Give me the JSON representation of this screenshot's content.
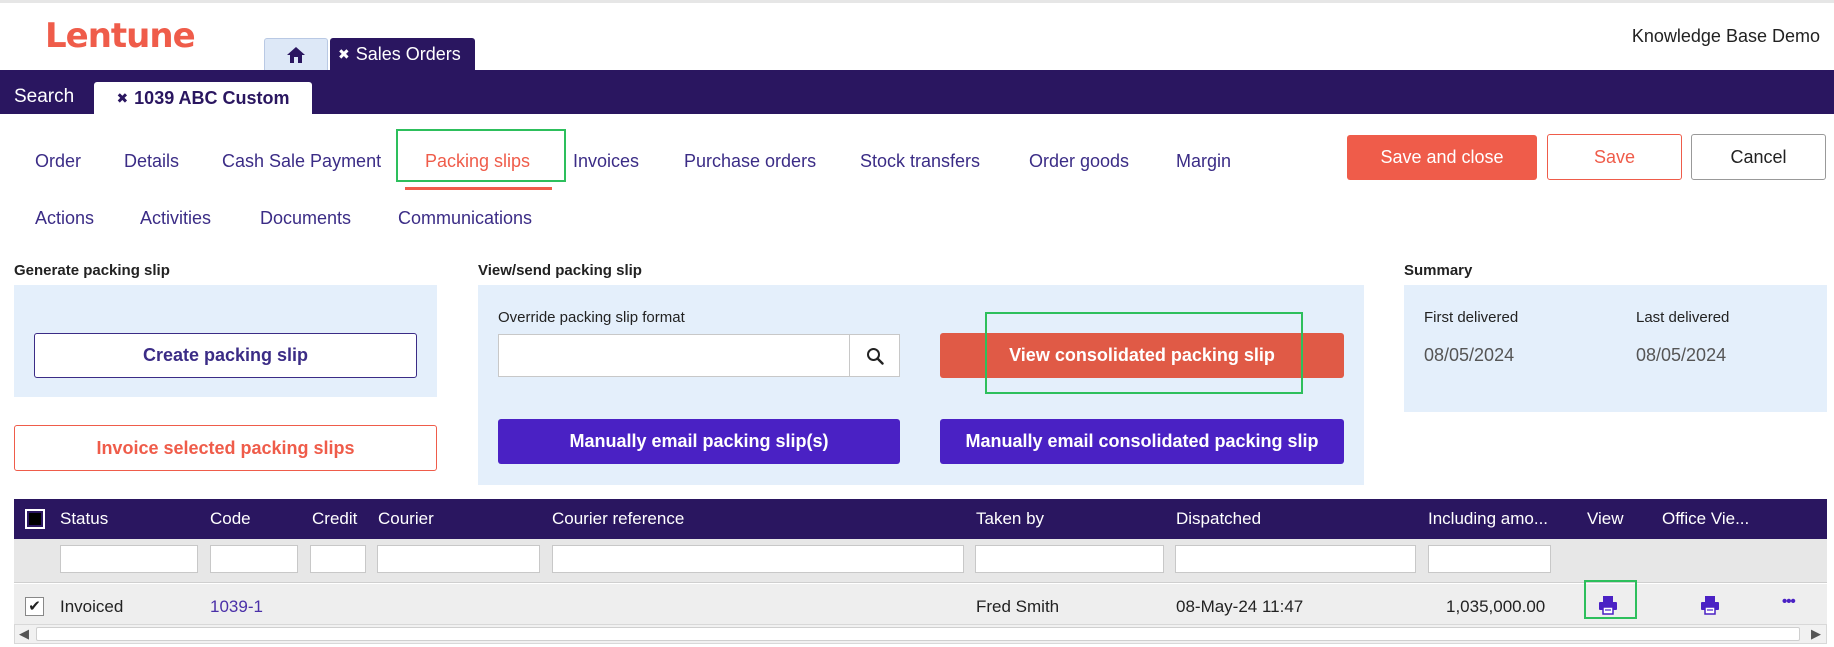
{
  "app": {
    "logo_text": "Lentune",
    "workspace": "Knowledge Base Demo",
    "tabs": [
      {
        "label": "Sales Orders",
        "close": "✖"
      }
    ],
    "subtabs": [
      {
        "label": "Search"
      },
      {
        "label": "1039 ABC Custom",
        "close": "✖"
      }
    ]
  },
  "nav": {
    "row1": [
      "Order",
      "Details",
      "Cash Sale Payment",
      "Packing slips",
      "Invoices",
      "Purchase orders",
      "Stock transfers",
      "Order goods",
      "Margin"
    ],
    "row2": [
      "Actions",
      "Activities",
      "Documents",
      "Communications"
    ],
    "active": "Packing slips"
  },
  "actions": {
    "save_close": "Save and close",
    "save": "Save",
    "cancel": "Cancel"
  },
  "generate": {
    "title": "Generate packing slip",
    "create_button": "Create packing slip",
    "invoice_button": "Invoice selected packing slips"
  },
  "view_send": {
    "title": "View/send packing slip",
    "override_label": "Override packing slip format",
    "override_value": "",
    "view_consolidated": "View consolidated packing slip",
    "manual_email": "Manually email packing slip(s)",
    "manual_email_consolidated": "Manually email consolidated packing slip"
  },
  "summary": {
    "title": "Summary",
    "first_delivered_label": "First delivered",
    "first_delivered_value": "08/05/2024",
    "last_delivered_label": "Last delivered",
    "last_delivered_value": "08/05/2024"
  },
  "table": {
    "columns": [
      "Status",
      "Code",
      "Credit",
      "Courier",
      "Courier reference",
      "Taken by",
      "Dispatched",
      "Including amo...",
      "View",
      "Office Vie..."
    ],
    "rows": [
      {
        "checked": true,
        "status": "Invoiced",
        "code": "1039-1",
        "credit": "",
        "courier": "",
        "courier_reference": "",
        "taken_by": "Fred Smith",
        "dispatched": "08-May-24 11:47",
        "amount": "1,035,000.00",
        "more": "•••"
      }
    ]
  },
  "colors": {
    "brand": "#ef5c4a",
    "primary": "#2a1660",
    "accent_purple": "#4a21c4",
    "highlight": "#2dbf5c"
  },
  "icons": {
    "home": "home-icon",
    "search": "search-icon",
    "print": "printer-icon",
    "more": "more-icon"
  }
}
